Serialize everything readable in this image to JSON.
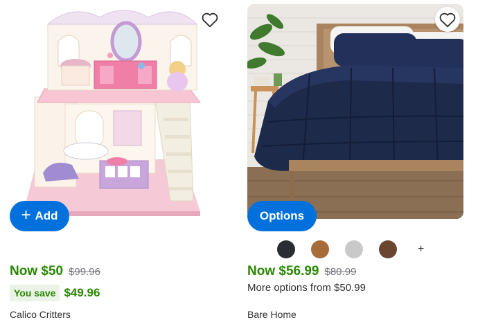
{
  "products": [
    {
      "image_alt": "Dollhouse toy playset",
      "cta_label": "Add",
      "price_now": "Now $50",
      "price_was": "$99.96",
      "save_label": "You save",
      "save_amount": "$49.96",
      "title_partial": "Calico Critters"
    },
    {
      "image_alt": "Navy comforter set on bed",
      "cta_label": "Options",
      "swatch_colors": [
        "#2a2c33",
        "#a86b3a",
        "#c9c9c9",
        "#6a4530"
      ],
      "more_swatches": "+",
      "price_now": "Now $56.99",
      "price_was": "$80.99",
      "more_options": "More options from $50.99",
      "title_partial": "Bare Home"
    }
  ],
  "colors": {
    "accent_blue": "#0071dc",
    "price_green": "#2a8703",
    "comforter_navy": "#1e2a4a"
  },
  "icons": {
    "favorite": "heart-outline-icon",
    "add": "plus-icon"
  }
}
